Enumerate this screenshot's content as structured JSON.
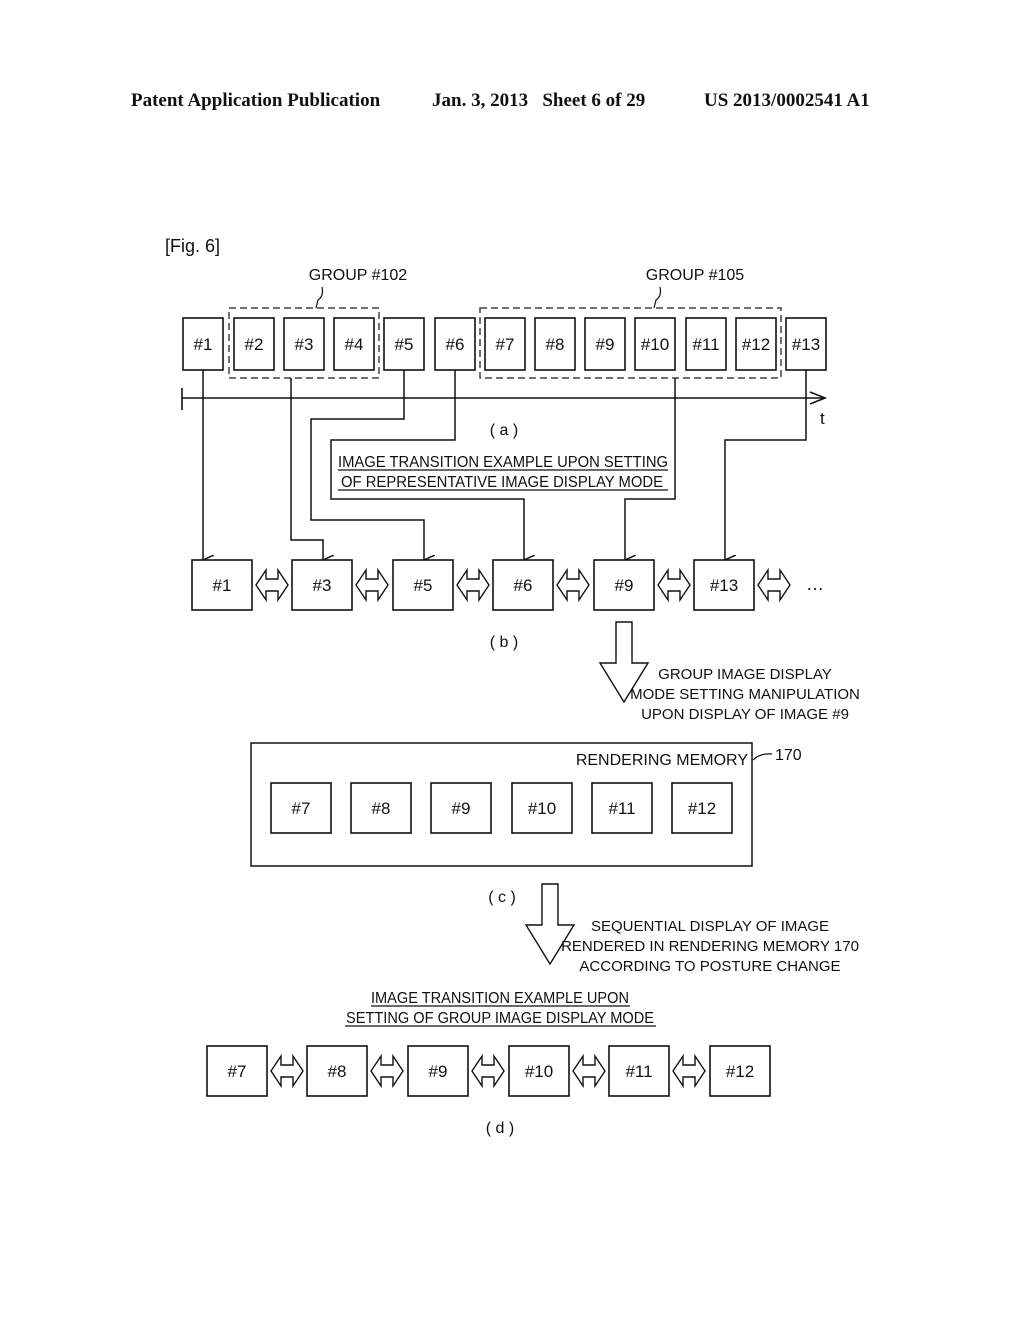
{
  "header": {
    "publication": "Patent Application Publication",
    "date_sheet": "Jan. 3, 2013   Sheet 6 of 29",
    "number": "US 2013/0002541 A1"
  },
  "figure": {
    "label": "[Fig. 6]",
    "top_row": [
      "#1",
      "#2",
      "#3",
      "#4",
      "#5",
      "#6",
      "#7",
      "#8",
      "#9",
      "#10",
      "#11",
      "#12",
      "#13"
    ],
    "groups": [
      {
        "label": "GROUP #102",
        "members": [
          "#2",
          "#3",
          "#4"
        ]
      },
      {
        "label": "GROUP #105",
        "members": [
          "#7",
          "#8",
          "#9",
          "#10",
          "#11",
          "#12"
        ]
      }
    ],
    "time_axis_label": "t",
    "part_a": "( a )",
    "representative_title": [
      "IMAGE TRANSITION EXAMPLE UPON SETTING",
      "OF REPRESENTATIVE IMAGE DISPLAY MODE"
    ],
    "representative_row": [
      "#1",
      "#3",
      "#5",
      "#6",
      "#9",
      "#13"
    ],
    "ellipsis": "…",
    "part_b": "( b )",
    "manipulation_note": [
      "GROUP IMAGE DISPLAY",
      "MODE SETTING MANIPULATION",
      "UPON DISPLAY OF IMAGE #9"
    ],
    "rendering_memory_label": "RENDERING MEMORY",
    "rendering_memory_ref": "170",
    "memory_row": [
      "#7",
      "#8",
      "#9",
      "#10",
      "#11",
      "#12"
    ],
    "part_c": "( c )",
    "sequential_note": [
      "SEQUENTIAL DISPLAY OF IMAGE",
      "RENDERED IN RENDERING MEMORY 170",
      "ACCORDING TO POSTURE CHANGE"
    ],
    "group_title": [
      "IMAGE TRANSITION EXAMPLE UPON",
      "SETTING OF GROUP IMAGE DISPLAY MODE"
    ],
    "group_row": [
      "#7",
      "#8",
      "#9",
      "#10",
      "#11",
      "#12"
    ],
    "part_d": "( d )"
  }
}
